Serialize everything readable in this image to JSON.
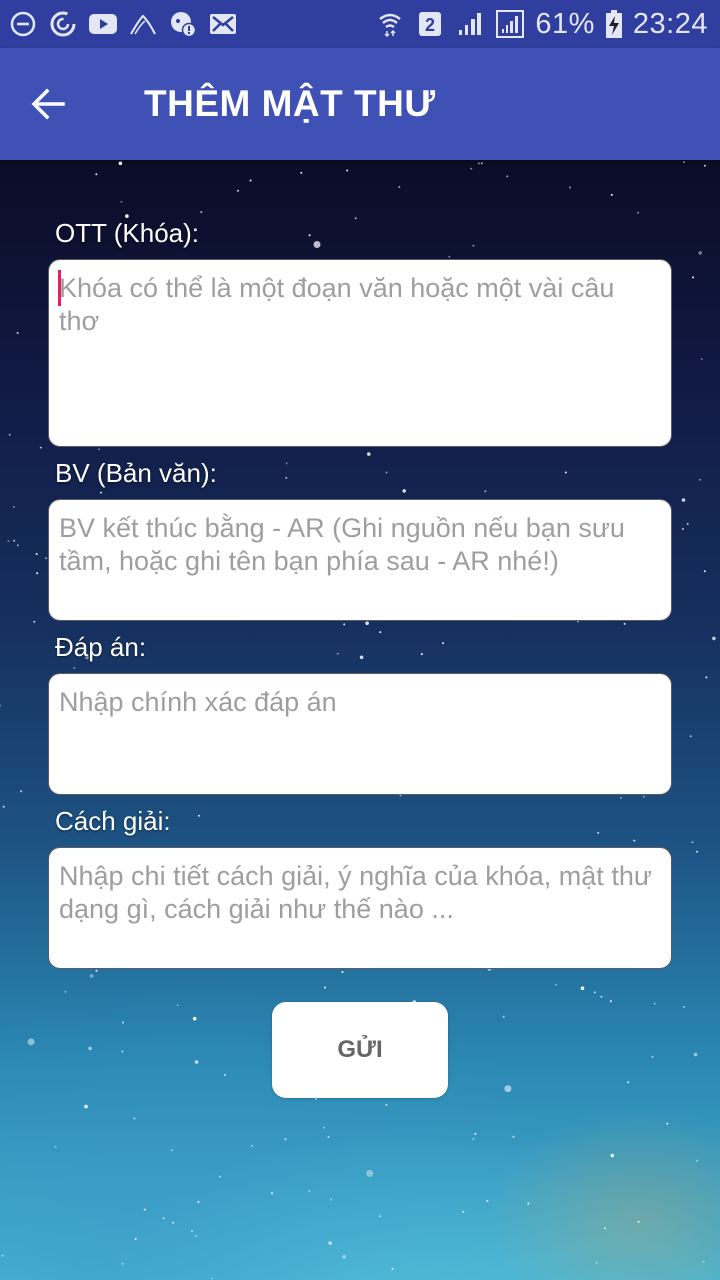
{
  "status_bar": {
    "left_icons": [
      "do-not-disturb-icon",
      "sync-icon",
      "youtube-icon",
      "app-icon",
      "data-saver-alert-icon",
      "mail-icon"
    ],
    "sim_slot": "2",
    "battery_percent": "61%",
    "time": "23:24"
  },
  "app_bar": {
    "back_icon": "arrow-back-icon",
    "title": "THÊM MẬT THƯ"
  },
  "form": {
    "fields": [
      {
        "label": "OTT (Khóa):",
        "value": "",
        "placeholder": "Khóa có thể là một đoạn văn hoặc một vài câu thơ",
        "focused": true
      },
      {
        "label": "BV (Bản văn):",
        "value": "",
        "placeholder": "BV kết thúc bằng - AR (Ghi nguồn nếu bạn sưu tầm, hoặc ghi tên bạn phía sau - AR nhé!)",
        "focused": false
      },
      {
        "label": "Đáp án:",
        "value": "",
        "placeholder": "Nhập chính xác đáp án",
        "focused": false
      },
      {
        "label": "Cách giải:",
        "value": "",
        "placeholder": "Nhập chi tiết cách giải, ý nghĩa của khóa, mật thư dạng gì, cách giải như thế nào ...",
        "focused": false
      }
    ],
    "submit_label": "GỬI"
  },
  "colors": {
    "status_bar": "#303f9f",
    "app_bar": "#3f51b5",
    "cursor": "#e91e63",
    "placeholder": "#9e9e9e"
  }
}
